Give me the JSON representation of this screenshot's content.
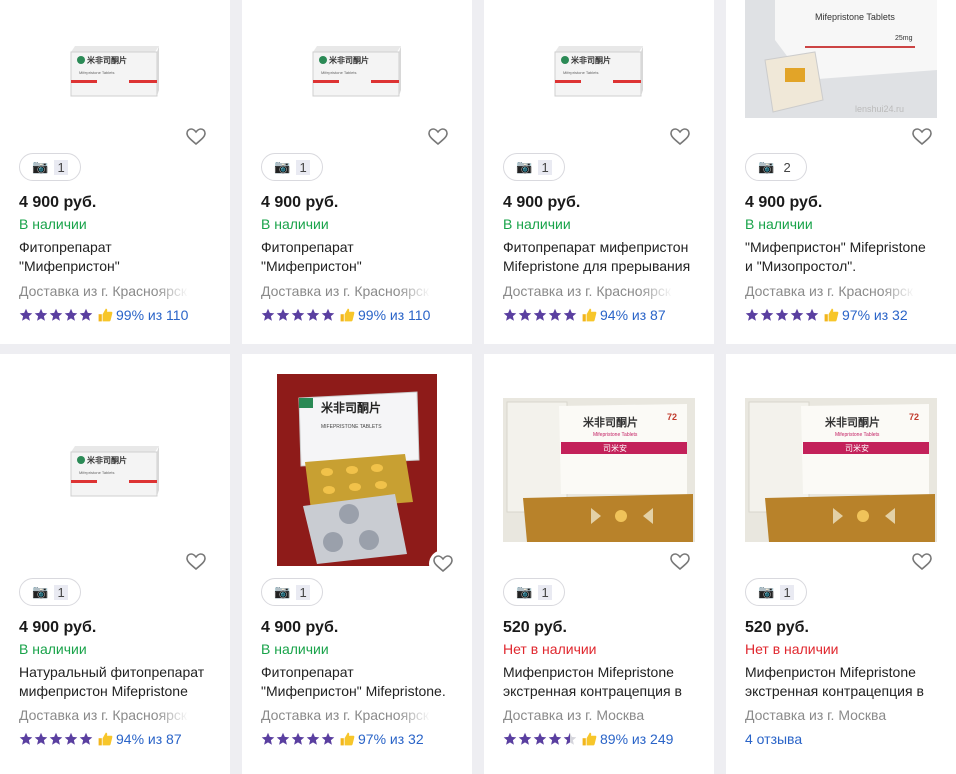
{
  "colors": {
    "in_stock": "#19a34a",
    "out_of_stock": "#e0272e",
    "link": "#2a64c8",
    "star": "#5a3fa0"
  },
  "products": [
    {
      "price": "4 900 руб.",
      "availability": "В наличии",
      "title_line1": "Фитопрепарат",
      "title_line2": "\"Мифепристон\"",
      "delivery": "Доставка из г. Красноярск",
      "photos": "1",
      "rating_text": "99% из 110",
      "stars": 5
    },
    {
      "price": "4 900 руб.",
      "availability": "В наличии",
      "title_line1": "Фитопрепарат",
      "title_line2": "\"Мифепристон\"",
      "delivery": "Доставка из г. Красноярск",
      "photos": "1",
      "rating_text": "99% из 110",
      "stars": 5
    },
    {
      "price": "4 900 руб.",
      "availability": "В наличии",
      "title_line1": "Фитопрепарат мифепристон",
      "title_line2": "Mifepristone для прерывания",
      "delivery": "Доставка из г. Красноярск",
      "photos": "1",
      "rating_text": "94% из 87",
      "stars": 5
    },
    {
      "price": "4 900 руб.",
      "availability": "В наличии",
      "title_line1": "\"Мифепристон\" Mifepristone",
      "title_line2": "и \"Мизопростол\".",
      "delivery": "Доставка из г. Красноярск",
      "photos": "2",
      "rating_text": "97% из 32",
      "stars": 5
    },
    {
      "price": "4 900 руб.",
      "availability": "В наличии",
      "title_line1": "Натуральный фитопрепарат",
      "title_line2": "мифепристон Mifepristone",
      "delivery": "Доставка из г. Красноярск",
      "photos": "1",
      "rating_text": "94% из 87",
      "stars": 5
    },
    {
      "price": "4 900 руб.",
      "availability": "В наличии",
      "title_line1": "Фитопрепарат",
      "title_line2": "\"Мифепристон\" Mifepristone.",
      "delivery": "Доставка из г. Красноярск",
      "photos": "1",
      "rating_text": "97% из 32",
      "stars": 5
    },
    {
      "price": "520 руб.",
      "availability": "Нет в наличии",
      "title_line1": "Мифепристон Mifepristone",
      "title_line2": "экстренная контрацепция в",
      "delivery": "Доставка из г. Москва",
      "photos": "1",
      "rating_text": "89% из 249",
      "stars": 4.5
    },
    {
      "price": "520 руб.",
      "availability": "Нет в наличии",
      "title_line1": "Мифепристон Mifepristone",
      "title_line2": "экстренная контрацепция в",
      "delivery": "Доставка из г. Москва",
      "photos": "1",
      "reviews": "4 отзыва"
    }
  ],
  "package_text": {
    "cn_title": "米非司酮片",
    "en_title": "Mifepristone Tablets",
    "en_title_caps": "MIFEPRISTONE TABLETS",
    "dose": "25mg",
    "cn_title2": "司米安",
    "badge": "72",
    "watermark": "lenshui24.ru"
  }
}
